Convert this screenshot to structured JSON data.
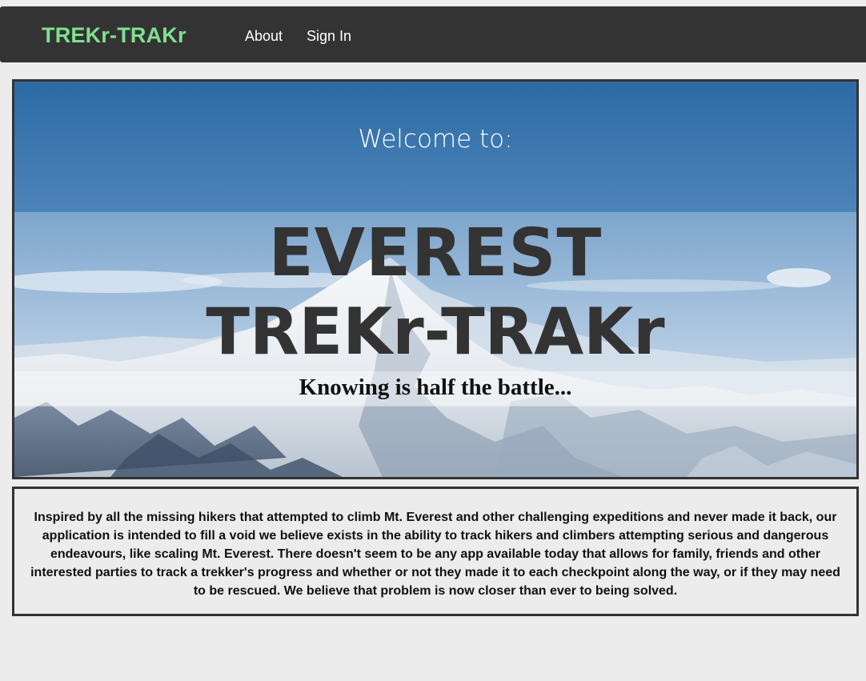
{
  "nav": {
    "brand": "TREKr-TRAKr",
    "links": [
      {
        "label": "About"
      },
      {
        "label": "Sign In"
      }
    ]
  },
  "hero": {
    "welcome": "Welcome to:",
    "title_line_1": "EVEREST",
    "title_line_2": "TREKr-TRAKr",
    "tagline": "Knowing is half the battle..."
  },
  "about": {
    "text": "Inspired by all the missing hikers that attempted to climb Mt. Everest and other challenging expeditions and never made it back, our application is intended to fill a void we believe exists in the ability to track hikers and climbers attempting serious and dangerous endeavours, like scaling Mt. Everest. There doesn't seem to be any app available today that allows for family, friends and other interested parties to track a trekker's progress and whether or not they made it to each checkpoint along the way, or if they may need to be rescued. We believe that problem is now closer than ever to being solved."
  },
  "colors": {
    "navbar_bg": "#333333",
    "brand": "#7fe08f",
    "page_bg": "#ececec",
    "title": "#333333"
  }
}
